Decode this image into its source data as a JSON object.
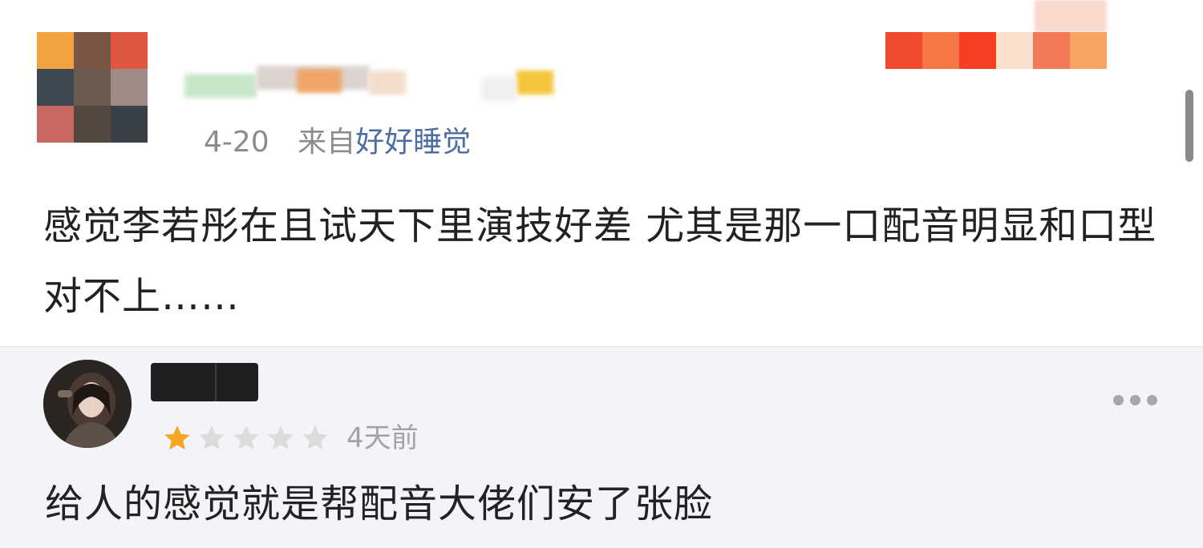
{
  "post": {
    "date": "4-20",
    "from_prefix": "来自",
    "source_app": "好好睡觉",
    "text": "感觉李若彤在且试天下里演技好差  尤其是那一口配音明显和口型对不上……"
  },
  "reply": {
    "rating": 1,
    "rating_max": 5,
    "time": "4天前",
    "text": "给人的感觉就是帮配音大佬们安了张脸"
  },
  "colors": {
    "link_blue": "#4b6da3",
    "meta_gray": "#8c8c8c",
    "star_active": "#f5a623",
    "star_inactive": "#dcdcdc",
    "reply_bg": "#f3f4f7"
  },
  "icons": {
    "more": "more-horizontal-icon",
    "star": "star-icon"
  }
}
